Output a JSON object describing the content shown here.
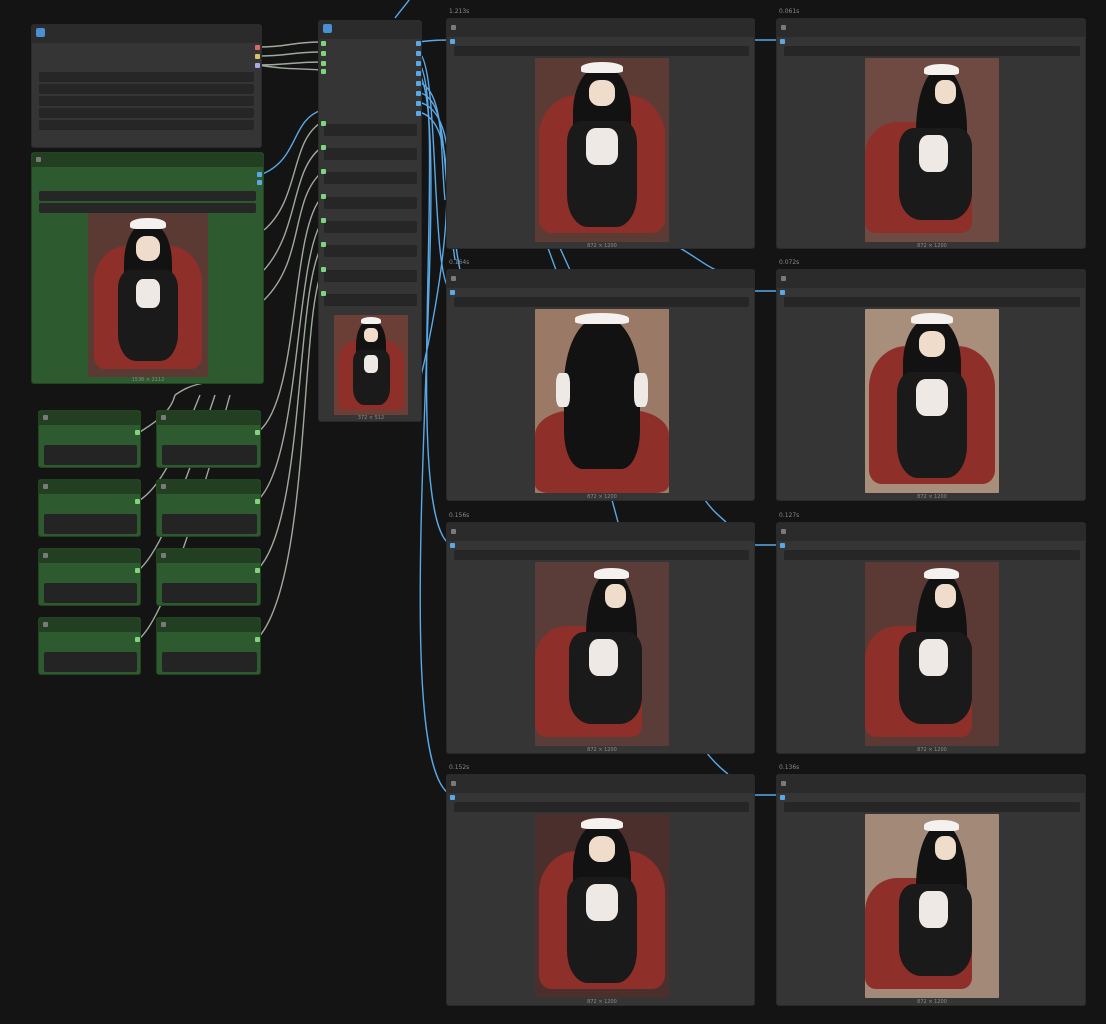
{
  "canvas": {
    "background": "#141414",
    "wire_color_blue": "#5aa9e6",
    "wire_color_grey": "#b8c4b4"
  },
  "loader_image": {
    "caption": "1536 × 2112"
  },
  "preview_image": {
    "caption": "372 × 512"
  },
  "results": [
    {
      "time": "1.213s",
      "caption": "872 × 1200"
    },
    {
      "time": "0.061s",
      "caption": "872 × 1200"
    },
    {
      "time": "0.164s",
      "caption": "872 × 1200"
    },
    {
      "time": "0.072s",
      "caption": "872 × 1200"
    },
    {
      "time": "0.156s",
      "caption": "872 × 1200"
    },
    {
      "time": "0.127s",
      "caption": "872 × 1200"
    },
    {
      "time": "0.152s",
      "caption": "872 × 1200"
    },
    {
      "time": "0.136s",
      "caption": "872 × 1200"
    }
  ]
}
